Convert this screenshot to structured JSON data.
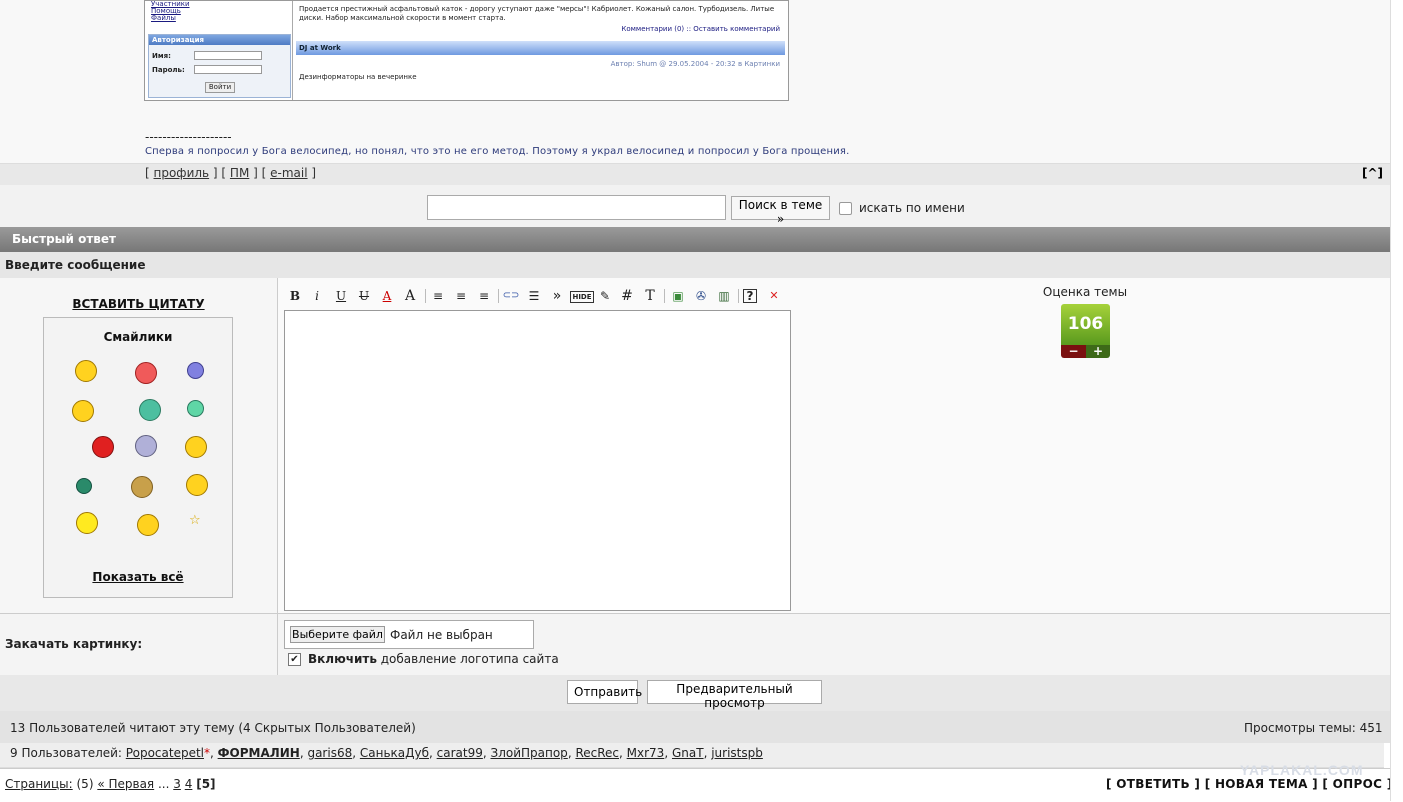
{
  "embedded": {
    "links": [
      "Участники",
      "Помощь",
      "Файлы"
    ],
    "auth_title": "Авторизация",
    "name_label": "Имя:",
    "password_label": "Пароль:",
    "login_button": "Войти",
    "ad_text": "Продается престижный асфальтовый каток - дорогу уступают даже \"мерсы\"! Кабриолет. Кожаный салон. Турбодизель. Литые диски. Набор максимальной скорости в момент старта.",
    "comments_link": "Комментарии (0) :: Оставить комментарий",
    "news_title": "DJ at Work",
    "author_line": "Автор: Shum @ 29.05.2004 - 20:32 в Картинки",
    "news_body": "Дезинформаторы на вечеринке"
  },
  "signature": {
    "separator": "--------------------",
    "text": "Сперва я попросил у Бога велосипед, но понял, что это не его метод. Поэтому я украл велосипед и попросил у Бога прощения."
  },
  "post_links": {
    "profile": "профиль",
    "pm": "ПМ",
    "email": "e-mail",
    "to_top": "[^]"
  },
  "search": {
    "button": "Поиск в теме »",
    "by_name_label": "искать по имени"
  },
  "quick_reply": {
    "title": "Быстрый ответ",
    "enter_message": "Введите сообщение",
    "insert_quote": "ВСТАВИТЬ ЦИТАТУ",
    "smilies_title": "Смайлики",
    "show_all": "Показать всё"
  },
  "toolbar_icons": [
    "bold-icon",
    "italic-icon",
    "underline-icon",
    "strike-icon",
    "font-color-icon",
    "font-size-icon",
    "align-left-icon",
    "align-center-icon",
    "align-right-icon",
    "link-icon",
    "list-icon",
    "quote-icon",
    "hide-icon",
    "edit-icon",
    "code-icon",
    "font-icon",
    "image-icon",
    "media-icon",
    "video-icon",
    "help-icon",
    "close-icon"
  ],
  "toolbar_glyphs": {
    "bold": "B",
    "italic": "i",
    "underline": "U",
    "strike": "U",
    "color": "A",
    "size": "A",
    "align_left": "≡",
    "align_center": "≡",
    "align_right": "≡",
    "link": "⊂⊃",
    "list": "☰",
    "quote": "»",
    "hide": "HIDE",
    "edit": "✎",
    "code": "#",
    "font": "T",
    "image": "▣",
    "media": "✇",
    "video": "▥",
    "help": "?",
    "close": "✕"
  },
  "rating": {
    "label": "Оценка темы",
    "value": "106",
    "minus": "−",
    "plus": "+"
  },
  "upload": {
    "label": "Закачать картинку:",
    "file_button": "Выберите файл",
    "file_status": "Файл не выбран",
    "logo_bold": "Включить",
    "logo_rest": " добавление логотипа сайта",
    "logo_checked": true
  },
  "buttons": {
    "send": "Отправить",
    "preview": "Предварительный просмотр"
  },
  "readers": {
    "summary": "13 Пользователей читают эту тему (4 Скрытых Пользователей)",
    "views": "Просмотры темы: 451",
    "users_prefix": "9 Пользователей: ",
    "users": [
      "Popocatepetl",
      "ФОРМАЛИН",
      "garis68",
      "СанькаДуб",
      "carat99",
      "ЗлойПрапор",
      "RecRec",
      "Mxr73",
      "GnaT",
      "juristspb"
    ]
  },
  "pager": {
    "label": "Страницы:",
    "count": "(5)",
    "first": "« Первая",
    "dots": "...",
    "p3": "3",
    "p4": "4",
    "current": "[5]"
  },
  "actions": {
    "reply": "[ ОТВЕТИТЬ ]",
    "new_topic": "[ НОВАЯ ТЕМА ]",
    "poll": "[ ОПРОС ]"
  },
  "watermark": "YAPLAKAL.COM",
  "colors": {
    "header_gray": "#888888",
    "rating_green": "#7fb52a",
    "rating_minus": "#7a1010",
    "rating_plus": "#3d6a18"
  }
}
